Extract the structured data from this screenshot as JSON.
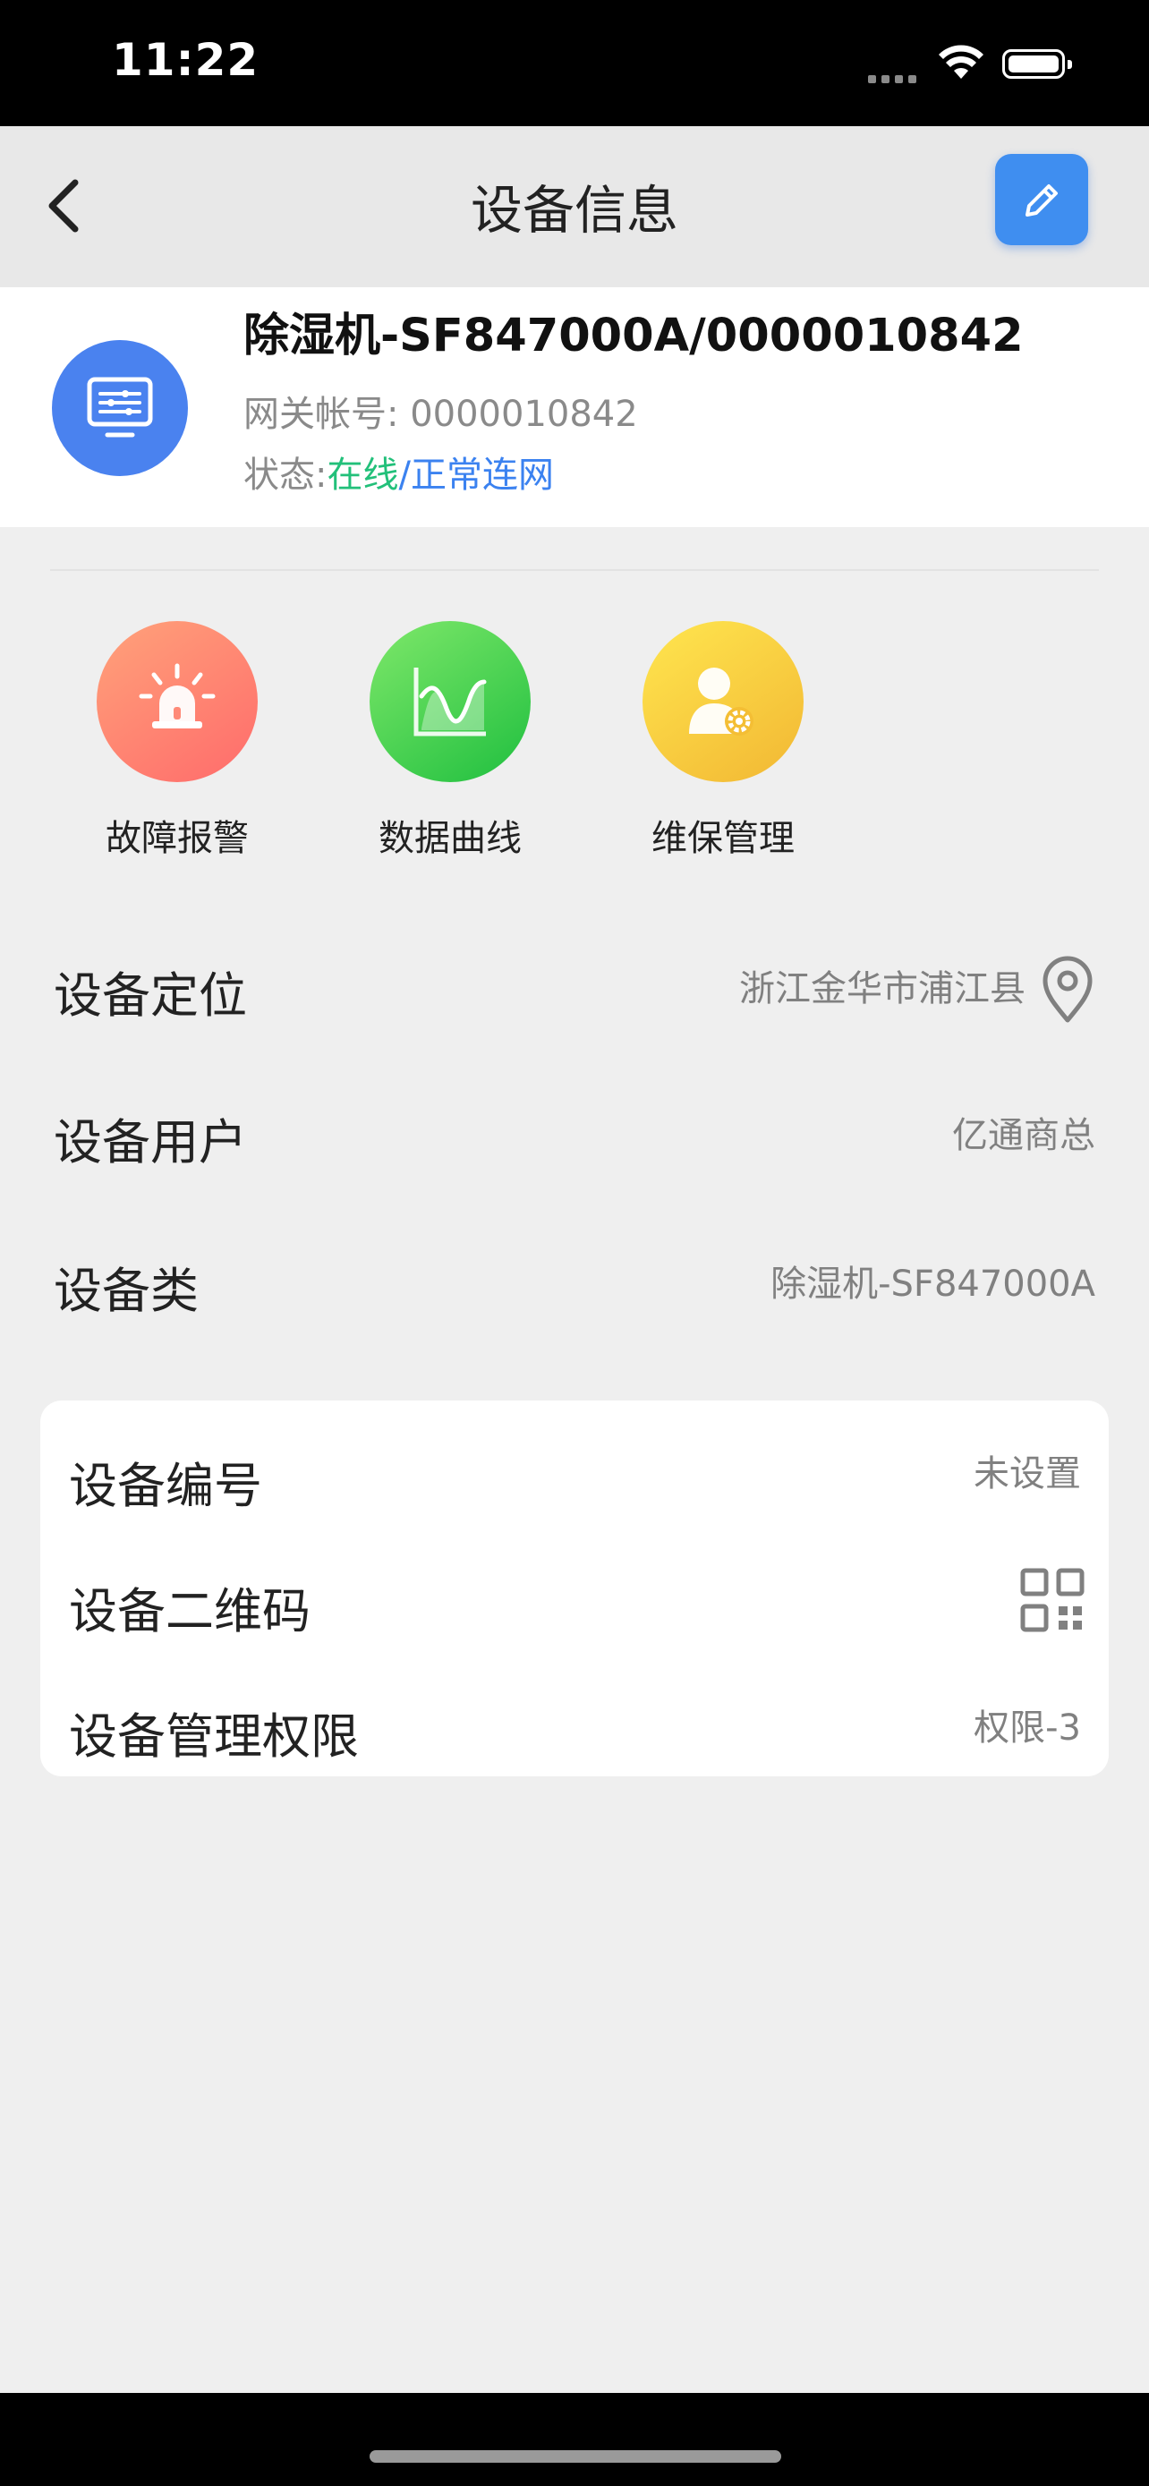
{
  "status_bar": {
    "time": "11:22"
  },
  "nav": {
    "title": "设备信息"
  },
  "device": {
    "name": "除湿机-SF847000A/0000010842",
    "gateway_label": "网关帐号:",
    "gateway_value": "0000010842",
    "status_label": "状态:",
    "status_online": "在线",
    "status_sep": "/",
    "status_network": "正常连网"
  },
  "actions": [
    {
      "label": "故障报警",
      "icon": "alarm-light-icon",
      "color": "#ff7a6a"
    },
    {
      "label": "数据曲线",
      "icon": "chart-curve-icon",
      "color": "#3fcf4a"
    },
    {
      "label": "维保管理",
      "icon": "maintenance-user-icon",
      "color": "#f7c93a"
    }
  ],
  "rows": {
    "location": {
      "label": "设备定位",
      "value": "浙江金华市浦江县"
    },
    "user": {
      "label": "设备用户",
      "value": "亿通商总"
    },
    "type": {
      "label": "设备类",
      "value": "除湿机-SF847000A"
    }
  },
  "card": {
    "serial": {
      "label": "设备编号",
      "value": "未设置"
    },
    "qrcode": {
      "label": "设备二维码"
    },
    "permission": {
      "label": "设备管理权限",
      "value": "权限-3"
    }
  },
  "colors": {
    "accent": "#3f8ef0",
    "online": "#22c07a",
    "network": "#3b82f0",
    "avatar": "#4a82ef"
  }
}
